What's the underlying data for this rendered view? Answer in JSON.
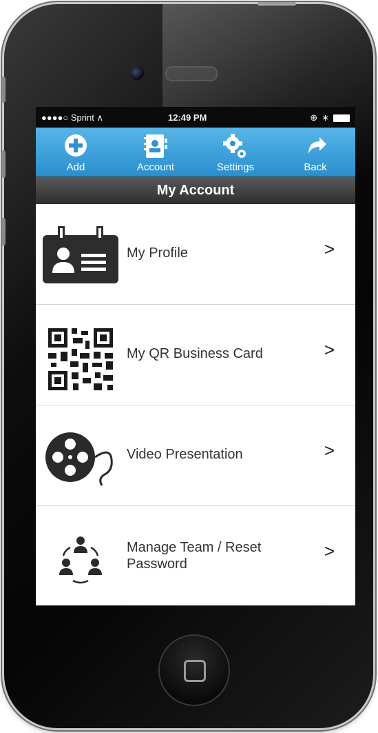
{
  "status": {
    "carrier": "●●●●○ Sprint ∧",
    "time": "12:49 PM"
  },
  "toolbar": {
    "items": [
      {
        "label": "Add",
        "icon": "add-circle-icon"
      },
      {
        "label": "Account",
        "icon": "address-book-icon"
      },
      {
        "label": "Settings",
        "icon": "gears-icon"
      },
      {
        "label": "Back",
        "icon": "back-arrow-icon"
      }
    ]
  },
  "title": "My Account",
  "menu": [
    {
      "label": "My Profile",
      "icon": "id-card-icon",
      "chevron": ">"
    },
    {
      "label": "My QR Business Card",
      "icon": "qr-code-icon",
      "chevron": ">"
    },
    {
      "label": "Video Presentation",
      "icon": "film-reel-icon",
      "chevron": ">"
    },
    {
      "label": "Manage Team / Reset Password",
      "icon": "team-icon",
      "chevron": ">"
    }
  ],
  "colors": {
    "toolbar_top": "#57b5e8",
    "toolbar_bottom": "#2a8fcf",
    "titlebar": "#3c3c3c"
  }
}
